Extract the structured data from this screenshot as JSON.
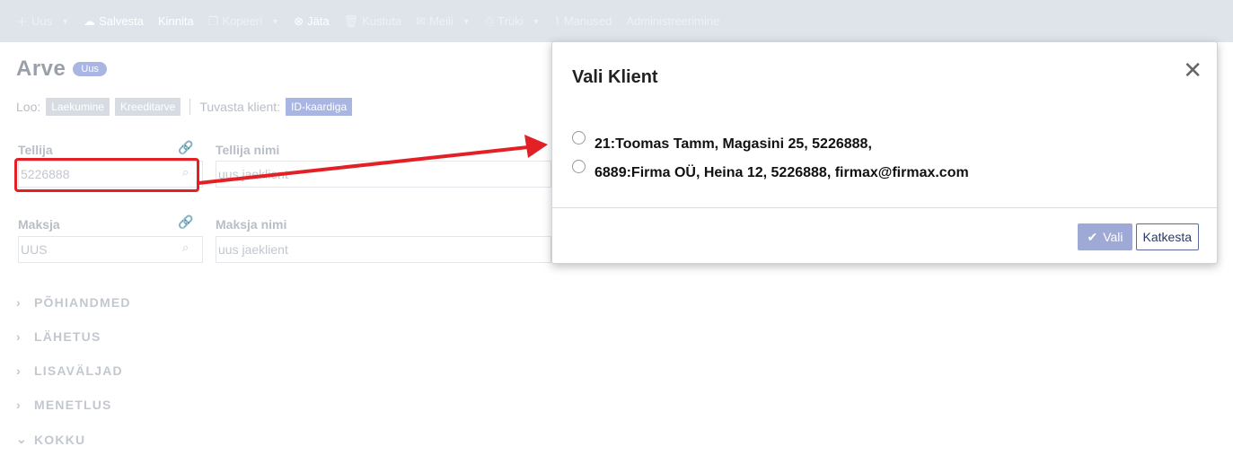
{
  "toolbar": {
    "items": [
      {
        "label": "Uus",
        "icon": "plus-icon",
        "caret": true,
        "style": "dim"
      },
      {
        "label": "Salvesta",
        "icon": "cloud-upload-icon",
        "caret": false,
        "style": "bright"
      },
      {
        "label": "Kinnita",
        "icon": "",
        "caret": false,
        "style": "bright"
      },
      {
        "label": "Kopeeri",
        "icon": "copy-icon",
        "caret": true,
        "style": "dim"
      },
      {
        "label": "Jäta",
        "icon": "circle-x-icon",
        "caret": false,
        "style": "bright"
      },
      {
        "label": "Kustuta",
        "icon": "trash-icon",
        "caret": false,
        "style": "dim"
      },
      {
        "label": "Meili",
        "icon": "mail-icon",
        "caret": true,
        "style": "dim"
      },
      {
        "label": "Trüki",
        "icon": "printer-icon",
        "caret": true,
        "style": "dim"
      },
      {
        "label": "Manused",
        "icon": "paperclip-icon",
        "caret": false,
        "style": "dim"
      },
      {
        "label": "Administreerimine",
        "icon": "",
        "caret": false,
        "style": "dim"
      }
    ]
  },
  "page": {
    "title": "Arve",
    "badge": "Uus",
    "create_label": "Loo:",
    "create_chips": [
      "Laekumine",
      "Kreeditarve"
    ],
    "identify_label": "Tuvasta klient:",
    "identify_chip": "ID-kaardiga"
  },
  "fields": {
    "tellija_label": "Tellija",
    "tellija_value": "5226888",
    "tellija_nimi_label": "Tellija nimi",
    "tellija_nimi_value": "uus jaeklient",
    "maksja_label": "Maksja",
    "maksja_value": "UUS",
    "maksja_nimi_label": "Maksja nimi",
    "maksja_nimi_value": "uus jaeklient"
  },
  "sections": [
    {
      "label": "PÕHIANDMED",
      "chevron": "›"
    },
    {
      "label": "LÄHETUS",
      "chevron": "›"
    },
    {
      "label": "LISAVÄLJAD",
      "chevron": "›"
    },
    {
      "label": "MENETLUS",
      "chevron": "›"
    },
    {
      "label": "KOKKU",
      "chevron": "⌄"
    }
  ],
  "modal": {
    "title": "Vali Klient",
    "close_glyph": "✕",
    "options": [
      "21:Toomas Tamm, Magasini 25, 5226888,",
      "6889:Firma OÜ, Heina 12, 5226888, firmax@firmax.com"
    ],
    "select_label": "Vali",
    "cancel_label": "Katkesta"
  },
  "colors": {
    "highlight": "#e32026",
    "accent": "#9ea9d6",
    "toolbar_bg": "#dfe3ea"
  }
}
